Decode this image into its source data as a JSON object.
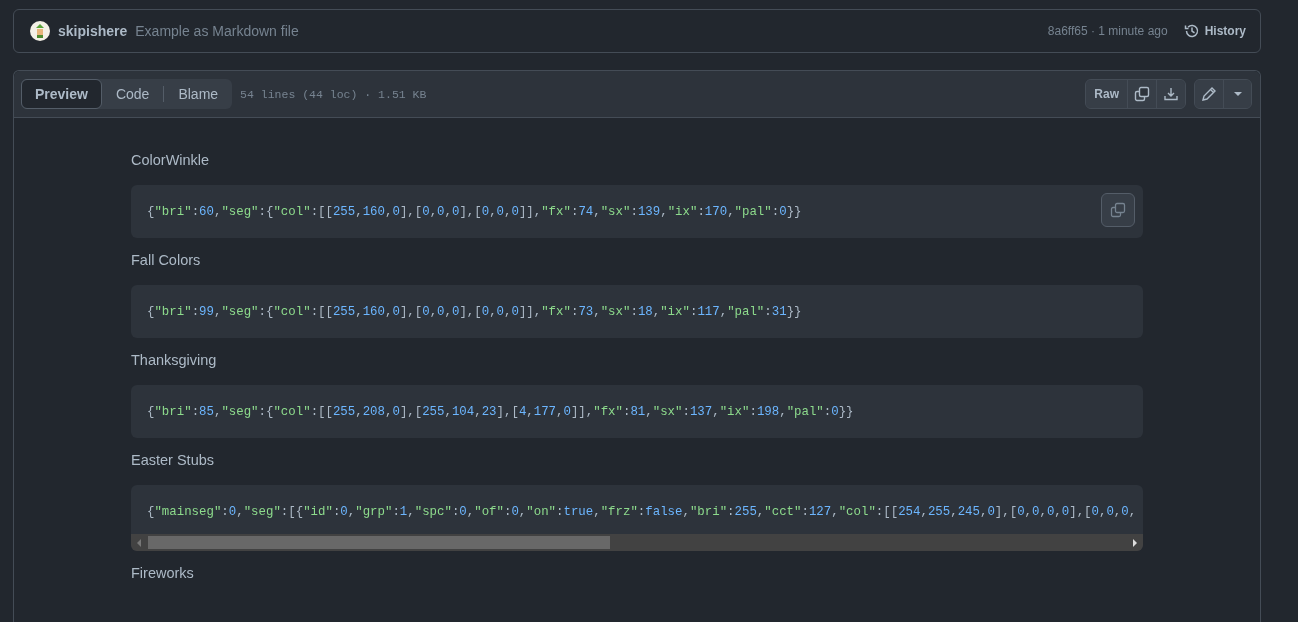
{
  "commit": {
    "author": "skipishere",
    "message": "Example as Markdown file",
    "sha_time": "8a6ff65 · 1 minute ago",
    "history": "History"
  },
  "file_header": {
    "tabs": [
      {
        "label": "Preview",
        "selected": true
      },
      {
        "label": "Code",
        "selected": false
      },
      {
        "label": "Blame",
        "selected": false
      }
    ],
    "info": "54 lines (44 loc) · 1.51 KB",
    "raw": "Raw"
  },
  "sections": [
    {
      "heading": "ColorWinkle",
      "code": "{\"bri\":60,\"seg\":{\"col\":[[255,160,0],[0,0,0],[0,0,0]],\"fx\":74,\"sx\":139,\"ix\":170,\"pal\":0}}",
      "copy_button": true,
      "scrollbar": false
    },
    {
      "heading": "Fall Colors",
      "code": "{\"bri\":99,\"seg\":{\"col\":[[255,160,0],[0,0,0],[0,0,0]],\"fx\":73,\"sx\":18,\"ix\":117,\"pal\":31}}",
      "copy_button": false,
      "scrollbar": false
    },
    {
      "heading": "Thanksgiving",
      "code": "{\"bri\":85,\"seg\":{\"col\":[[255,208,0],[255,104,23],[4,177,0]],\"fx\":81,\"sx\":137,\"ix\":198,\"pal\":0}}",
      "copy_button": false,
      "scrollbar": false
    },
    {
      "heading": "Easter Stubs",
      "code": "{\"mainseg\":0,\"seg\":[{\"id\":0,\"grp\":1,\"spc\":0,\"of\":0,\"on\":true,\"frz\":false,\"bri\":255,\"cct\":127,\"col\":[[254,255,245,0],[0,0,0,0],[0,0,0,",
      "copy_button": false,
      "scrollbar": true
    },
    {
      "heading": "Fireworks"
    }
  ]
}
